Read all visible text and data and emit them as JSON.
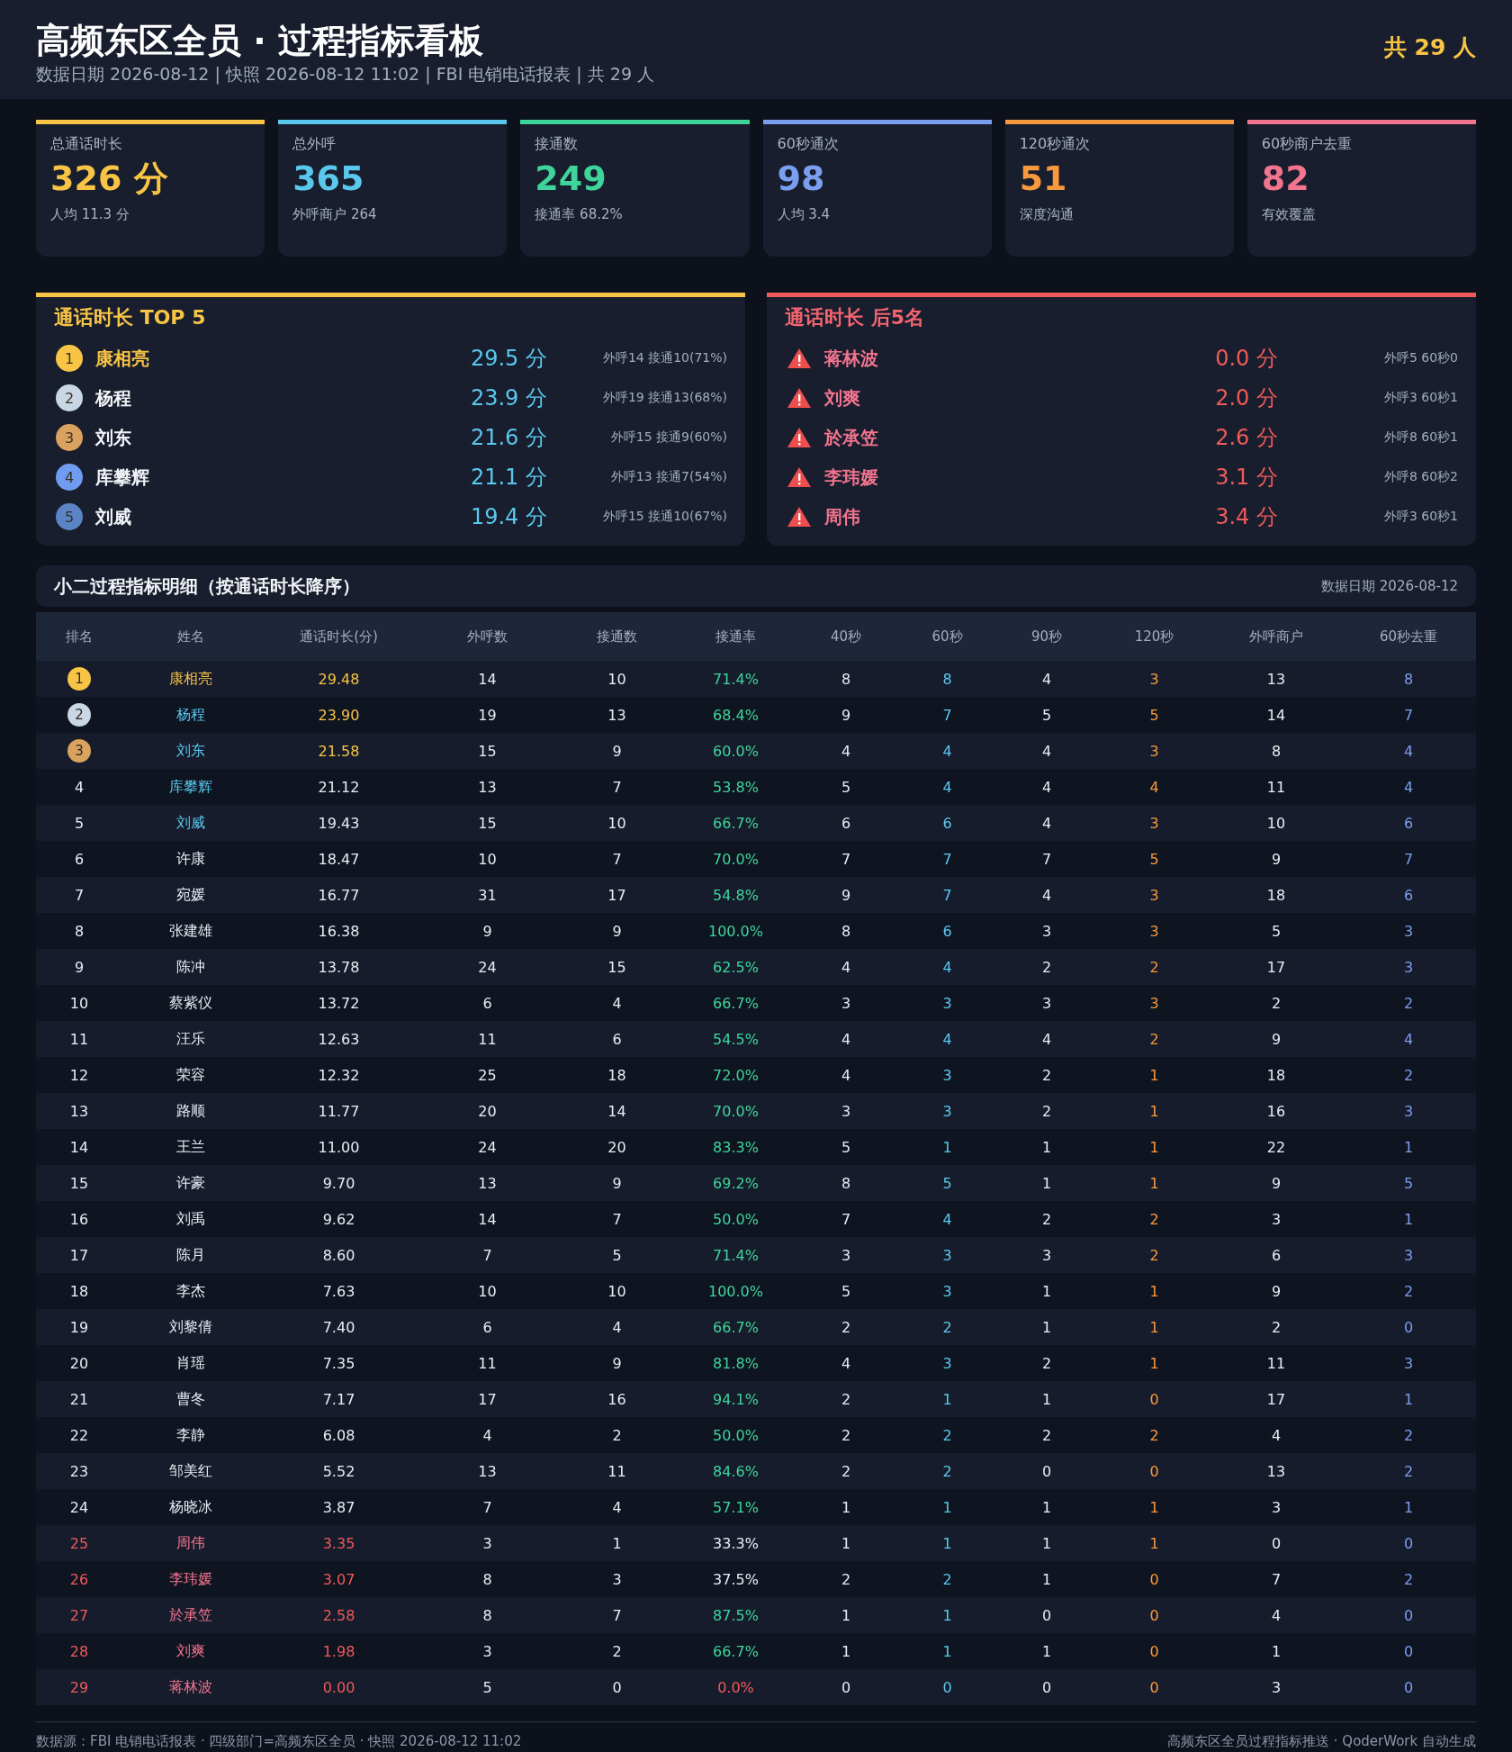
{
  "header": {
    "title": "高频东区全员 · 过程指标看板",
    "subtitle": "数据日期 2026-08-12 | 快照 2026-08-12 11:02 | FBI 电销电话报表 | 共 29 人",
    "total": "共 29 人"
  },
  "kpis": [
    {
      "label": "总通话时长",
      "value": "326 分",
      "sub": "人均 11.3 分",
      "color": "#f8c445"
    },
    {
      "label": "总外呼",
      "value": "365",
      "sub": "外呼商户 264",
      "color": "#5ac8ee"
    },
    {
      "label": "接通数",
      "value": "249",
      "sub": "接通率 68.2%",
      "color": "#3ed49a"
    },
    {
      "label": "60秒通次",
      "value": "98",
      "sub": "人均 3.4",
      "color": "#7b9ff0"
    },
    {
      "label": "120秒通次",
      "value": "51",
      "sub": "深度沟通",
      "color": "#f7993c"
    },
    {
      "label": "60秒商户去重",
      "value": "82",
      "sub": "有效覆盖",
      "color": "#f3748f"
    }
  ],
  "top5": {
    "title": "通话时长 TOP 5",
    "items": [
      {
        "rank": "1",
        "name": "康相亮",
        "value": "29.5 分",
        "detail": "外呼14 接通10(71%)",
        "color": "#f8c445"
      },
      {
        "rank": "2",
        "name": "杨程",
        "value": "23.9 分",
        "detail": "外呼19 接通13(68%)",
        "color": "#c9d6e4"
      },
      {
        "rank": "3",
        "name": "刘东",
        "value": "21.6 分",
        "detail": "外呼15 接通9(60%)",
        "color": "#d9a25f"
      },
      {
        "rank": "4",
        "name": "库攀辉",
        "value": "21.1 分",
        "detail": "外呼13 接通7(54%)",
        "color": "#6f9cf0"
      },
      {
        "rank": "5",
        "name": "刘威",
        "value": "19.4 分",
        "detail": "外呼15 接通10(67%)",
        "color": "#5b84c6"
      }
    ]
  },
  "bottom5": {
    "title": "通话时长 后5名",
    "items": [
      {
        "name": "蒋林波",
        "value": "0.0 分",
        "detail": "外呼5 60秒0"
      },
      {
        "name": "刘爽",
        "value": "2.0 分",
        "detail": "外呼3 60秒1"
      },
      {
        "name": "於承笠",
        "value": "2.6 分",
        "detail": "外呼8 60秒1"
      },
      {
        "name": "李玮媛",
        "value": "3.1 分",
        "detail": "外呼8 60秒2"
      },
      {
        "name": "周伟",
        "value": "3.4 分",
        "detail": "外呼3 60秒1"
      }
    ]
  },
  "table": {
    "title": "小二过程指标明细（按通话时长降序）",
    "date": "数据日期 2026-08-12",
    "columns": [
      "排名",
      "姓名",
      "通话时长(分)",
      "外呼数",
      "接通数",
      "接通率",
      "40秒",
      "60秒",
      "90秒",
      "120秒",
      "外呼商户",
      "60秒去重"
    ],
    "rows": [
      {
        "kind": "gold",
        "cells": [
          "1",
          "康相亮",
          "29.48",
          "14",
          "10",
          "71.4%",
          "8",
          "8",
          "4",
          "3",
          "13",
          "8"
        ]
      },
      {
        "kind": "silver",
        "cells": [
          "2",
          "杨程",
          "23.90",
          "19",
          "13",
          "68.4%",
          "9",
          "7",
          "5",
          "5",
          "14",
          "7"
        ]
      },
      {
        "kind": "bronze",
        "cells": [
          "3",
          "刘东",
          "21.58",
          "15",
          "9",
          "60.0%",
          "4",
          "4",
          "4",
          "3",
          "8",
          "4"
        ]
      },
      {
        "kind": "top",
        "cells": [
          "4",
          "库攀辉",
          "21.12",
          "13",
          "7",
          "53.8%",
          "5",
          "4",
          "4",
          "4",
          "11",
          "4"
        ]
      },
      {
        "kind": "top",
        "cells": [
          "5",
          "刘威",
          "19.43",
          "15",
          "10",
          "66.7%",
          "6",
          "6",
          "4",
          "3",
          "10",
          "6"
        ]
      },
      {
        "kind": "normal",
        "cells": [
          "6",
          "许康",
          "18.47",
          "10",
          "7",
          "70.0%",
          "7",
          "7",
          "7",
          "5",
          "9",
          "7"
        ]
      },
      {
        "kind": "normal",
        "cells": [
          "7",
          "宛媛",
          "16.77",
          "31",
          "17",
          "54.8%",
          "9",
          "7",
          "4",
          "3",
          "18",
          "6"
        ]
      },
      {
        "kind": "normal",
        "cells": [
          "8",
          "张建雄",
          "16.38",
          "9",
          "9",
          "100.0%",
          "8",
          "6",
          "3",
          "3",
          "5",
          "3"
        ]
      },
      {
        "kind": "normal",
        "cells": [
          "9",
          "陈冲",
          "13.78",
          "24",
          "15",
          "62.5%",
          "4",
          "4",
          "2",
          "2",
          "17",
          "3"
        ]
      },
      {
        "kind": "normal",
        "cells": [
          "10",
          "蔡紫仪",
          "13.72",
          "6",
          "4",
          "66.7%",
          "3",
          "3",
          "3",
          "3",
          "2",
          "2"
        ]
      },
      {
        "kind": "normal",
        "cells": [
          "11",
          "汪乐",
          "12.63",
          "11",
          "6",
          "54.5%",
          "4",
          "4",
          "4",
          "2",
          "9",
          "4"
        ]
      },
      {
        "kind": "normal",
        "cells": [
          "12",
          "荣容",
          "12.32",
          "25",
          "18",
          "72.0%",
          "4",
          "3",
          "2",
          "1",
          "18",
          "2"
        ]
      },
      {
        "kind": "normal",
        "cells": [
          "13",
          "路顺",
          "11.77",
          "20",
          "14",
          "70.0%",
          "3",
          "3",
          "2",
          "1",
          "16",
          "3"
        ]
      },
      {
        "kind": "normal",
        "cells": [
          "14",
          "王兰",
          "11.00",
          "24",
          "20",
          "83.3%",
          "5",
          "1",
          "1",
          "1",
          "22",
          "1"
        ]
      },
      {
        "kind": "normal",
        "cells": [
          "15",
          "许豪",
          "9.70",
          "13",
          "9",
          "69.2%",
          "8",
          "5",
          "1",
          "1",
          "9",
          "5"
        ]
      },
      {
        "kind": "normal",
        "cells": [
          "16",
          "刘禹",
          "9.62",
          "14",
          "7",
          "50.0%",
          "7",
          "4",
          "2",
          "2",
          "3",
          "1"
        ]
      },
      {
        "kind": "normal",
        "cells": [
          "17",
          "陈月",
          "8.60",
          "7",
          "5",
          "71.4%",
          "3",
          "3",
          "3",
          "2",
          "6",
          "3"
        ]
      },
      {
        "kind": "normal",
        "cells": [
          "18",
          "李杰",
          "7.63",
          "10",
          "10",
          "100.0%",
          "5",
          "3",
          "1",
          "1",
          "9",
          "2"
        ]
      },
      {
        "kind": "normal",
        "cells": [
          "19",
          "刘黎倩",
          "7.40",
          "6",
          "4",
          "66.7%",
          "2",
          "2",
          "1",
          "1",
          "2",
          "0"
        ]
      },
      {
        "kind": "normal",
        "cells": [
          "20",
          "肖瑶",
          "7.35",
          "11",
          "9",
          "81.8%",
          "4",
          "3",
          "2",
          "1",
          "11",
          "3"
        ]
      },
      {
        "kind": "normal",
        "cells": [
          "21",
          "曹冬",
          "7.17",
          "17",
          "16",
          "94.1%",
          "2",
          "1",
          "1",
          "0",
          "17",
          "1"
        ]
      },
      {
        "kind": "normal",
        "cells": [
          "22",
          "李静",
          "6.08",
          "4",
          "2",
          "50.0%",
          "2",
          "2",
          "2",
          "2",
          "4",
          "2"
        ]
      },
      {
        "kind": "normal",
        "cells": [
          "23",
          "邹美红",
          "5.52",
          "13",
          "11",
          "84.6%",
          "2",
          "2",
          "0",
          "0",
          "13",
          "2"
        ]
      },
      {
        "kind": "normal",
        "cells": [
          "24",
          "杨晓冰",
          "3.87",
          "7",
          "4",
          "57.1%",
          "1",
          "1",
          "1",
          "1",
          "3",
          "1"
        ]
      },
      {
        "kind": "bottomlow",
        "cells": [
          "25",
          "周伟",
          "3.35",
          "3",
          "1",
          "33.3%",
          "1",
          "1",
          "1",
          "1",
          "0",
          "0"
        ]
      },
      {
        "kind": "bottomlow",
        "cells": [
          "26",
          "李玮媛",
          "3.07",
          "8",
          "3",
          "37.5%",
          "2",
          "2",
          "1",
          "0",
          "7",
          "2"
        ]
      },
      {
        "kind": "bottom",
        "cells": [
          "27",
          "於承笠",
          "2.58",
          "8",
          "7",
          "87.5%",
          "1",
          "1",
          "0",
          "0",
          "4",
          "0"
        ]
      },
      {
        "kind": "bottom",
        "cells": [
          "28",
          "刘爽",
          "1.98",
          "3",
          "2",
          "66.7%",
          "1",
          "1",
          "1",
          "0",
          "1",
          "0"
        ]
      },
      {
        "kind": "bottomzero",
        "cells": [
          "29",
          "蒋林波",
          "0.00",
          "5",
          "0",
          "0.0%",
          "0",
          "0",
          "0",
          "0",
          "3",
          "0"
        ]
      }
    ]
  },
  "footer": {
    "left": "数据源：FBI 电销电话报表 · 四级部门=高频东区全员 · 快照 2026-08-12 11:02",
    "right": "高频东区全员过程指标推送 · QoderWork 自动生成"
  }
}
